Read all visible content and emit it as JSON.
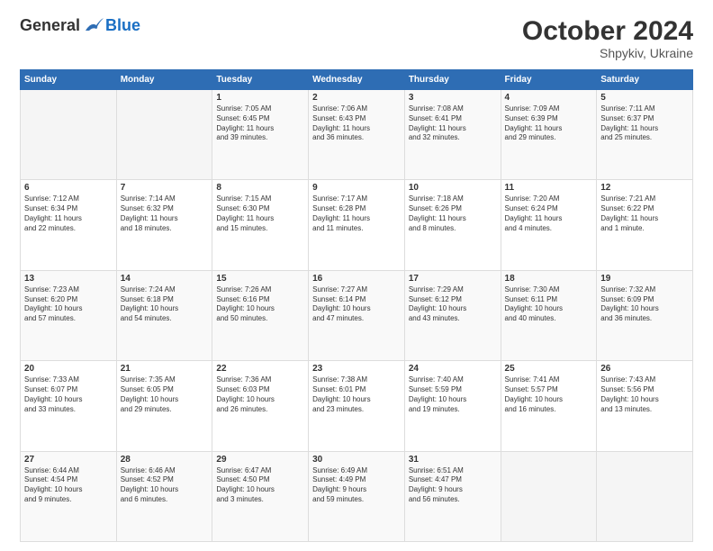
{
  "header": {
    "logo_general": "General",
    "logo_blue": "Blue",
    "month_title": "October 2024",
    "location": "Shpykiv, Ukraine"
  },
  "days_of_week": [
    "Sunday",
    "Monday",
    "Tuesday",
    "Wednesday",
    "Thursday",
    "Friday",
    "Saturday"
  ],
  "weeks": [
    [
      {
        "num": "",
        "detail": ""
      },
      {
        "num": "",
        "detail": ""
      },
      {
        "num": "1",
        "detail": "Sunrise: 7:05 AM\nSunset: 6:45 PM\nDaylight: 11 hours\nand 39 minutes."
      },
      {
        "num": "2",
        "detail": "Sunrise: 7:06 AM\nSunset: 6:43 PM\nDaylight: 11 hours\nand 36 minutes."
      },
      {
        "num": "3",
        "detail": "Sunrise: 7:08 AM\nSunset: 6:41 PM\nDaylight: 11 hours\nand 32 minutes."
      },
      {
        "num": "4",
        "detail": "Sunrise: 7:09 AM\nSunset: 6:39 PM\nDaylight: 11 hours\nand 29 minutes."
      },
      {
        "num": "5",
        "detail": "Sunrise: 7:11 AM\nSunset: 6:37 PM\nDaylight: 11 hours\nand 25 minutes."
      }
    ],
    [
      {
        "num": "6",
        "detail": "Sunrise: 7:12 AM\nSunset: 6:34 PM\nDaylight: 11 hours\nand 22 minutes."
      },
      {
        "num": "7",
        "detail": "Sunrise: 7:14 AM\nSunset: 6:32 PM\nDaylight: 11 hours\nand 18 minutes."
      },
      {
        "num": "8",
        "detail": "Sunrise: 7:15 AM\nSunset: 6:30 PM\nDaylight: 11 hours\nand 15 minutes."
      },
      {
        "num": "9",
        "detail": "Sunrise: 7:17 AM\nSunset: 6:28 PM\nDaylight: 11 hours\nand 11 minutes."
      },
      {
        "num": "10",
        "detail": "Sunrise: 7:18 AM\nSunset: 6:26 PM\nDaylight: 11 hours\nand 8 minutes."
      },
      {
        "num": "11",
        "detail": "Sunrise: 7:20 AM\nSunset: 6:24 PM\nDaylight: 11 hours\nand 4 minutes."
      },
      {
        "num": "12",
        "detail": "Sunrise: 7:21 AM\nSunset: 6:22 PM\nDaylight: 11 hours\nand 1 minute."
      }
    ],
    [
      {
        "num": "13",
        "detail": "Sunrise: 7:23 AM\nSunset: 6:20 PM\nDaylight: 10 hours\nand 57 minutes."
      },
      {
        "num": "14",
        "detail": "Sunrise: 7:24 AM\nSunset: 6:18 PM\nDaylight: 10 hours\nand 54 minutes."
      },
      {
        "num": "15",
        "detail": "Sunrise: 7:26 AM\nSunset: 6:16 PM\nDaylight: 10 hours\nand 50 minutes."
      },
      {
        "num": "16",
        "detail": "Sunrise: 7:27 AM\nSunset: 6:14 PM\nDaylight: 10 hours\nand 47 minutes."
      },
      {
        "num": "17",
        "detail": "Sunrise: 7:29 AM\nSunset: 6:12 PM\nDaylight: 10 hours\nand 43 minutes."
      },
      {
        "num": "18",
        "detail": "Sunrise: 7:30 AM\nSunset: 6:11 PM\nDaylight: 10 hours\nand 40 minutes."
      },
      {
        "num": "19",
        "detail": "Sunrise: 7:32 AM\nSunset: 6:09 PM\nDaylight: 10 hours\nand 36 minutes."
      }
    ],
    [
      {
        "num": "20",
        "detail": "Sunrise: 7:33 AM\nSunset: 6:07 PM\nDaylight: 10 hours\nand 33 minutes."
      },
      {
        "num": "21",
        "detail": "Sunrise: 7:35 AM\nSunset: 6:05 PM\nDaylight: 10 hours\nand 29 minutes."
      },
      {
        "num": "22",
        "detail": "Sunrise: 7:36 AM\nSunset: 6:03 PM\nDaylight: 10 hours\nand 26 minutes."
      },
      {
        "num": "23",
        "detail": "Sunrise: 7:38 AM\nSunset: 6:01 PM\nDaylight: 10 hours\nand 23 minutes."
      },
      {
        "num": "24",
        "detail": "Sunrise: 7:40 AM\nSunset: 5:59 PM\nDaylight: 10 hours\nand 19 minutes."
      },
      {
        "num": "25",
        "detail": "Sunrise: 7:41 AM\nSunset: 5:57 PM\nDaylight: 10 hours\nand 16 minutes."
      },
      {
        "num": "26",
        "detail": "Sunrise: 7:43 AM\nSunset: 5:56 PM\nDaylight: 10 hours\nand 13 minutes."
      }
    ],
    [
      {
        "num": "27",
        "detail": "Sunrise: 6:44 AM\nSunset: 4:54 PM\nDaylight: 10 hours\nand 9 minutes."
      },
      {
        "num": "28",
        "detail": "Sunrise: 6:46 AM\nSunset: 4:52 PM\nDaylight: 10 hours\nand 6 minutes."
      },
      {
        "num": "29",
        "detail": "Sunrise: 6:47 AM\nSunset: 4:50 PM\nDaylight: 10 hours\nand 3 minutes."
      },
      {
        "num": "30",
        "detail": "Sunrise: 6:49 AM\nSunset: 4:49 PM\nDaylight: 9 hours\nand 59 minutes."
      },
      {
        "num": "31",
        "detail": "Sunrise: 6:51 AM\nSunset: 4:47 PM\nDaylight: 9 hours\nand 56 minutes."
      },
      {
        "num": "",
        "detail": ""
      },
      {
        "num": "",
        "detail": ""
      }
    ]
  ]
}
